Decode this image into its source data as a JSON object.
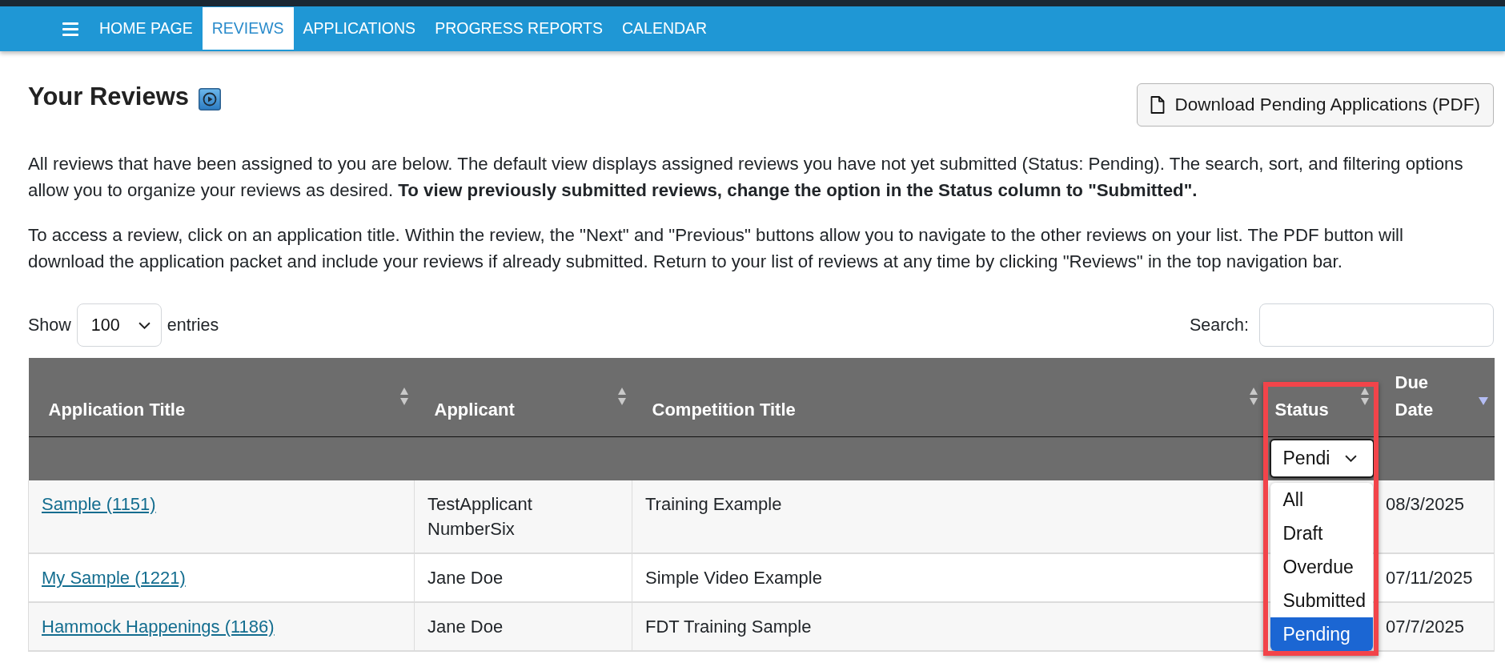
{
  "top_nav": {
    "items": [
      {
        "label": "HOME PAGE",
        "selected": false
      },
      {
        "label": "REVIEWS",
        "selected": true
      },
      {
        "label": "APPLICATIONS",
        "selected": false
      },
      {
        "label": "PROGRESS REPORTS",
        "selected": false
      },
      {
        "label": "CALENDAR",
        "selected": false
      }
    ]
  },
  "page": {
    "title": "Your Reviews",
    "download_button": "Download Pending Applications (PDF)",
    "paragraphs": [
      "All reviews that have been assigned to you are below. The default view displays assigned reviews you have not yet submitted (Status: Pending). The search, sort, and filtering options allow you to organize your reviews as desired. **To view previously submitted reviews, change the option in the Status column to \"Submitted\".**",
      "To access a review, click on an application title. Within the review, the \"Next\" and \"Previous\" buttons allow you to navigate to the other reviews on your list. The PDF button will download the application packet and include your reviews if already submitted. Return to your list of reviews at any time by clicking \"Reviews\" in the top navigation bar."
    ]
  },
  "table_controls": {
    "show_label": "Show",
    "page_size": "100",
    "entries_label": "entries",
    "search_label": "Search:"
  },
  "table": {
    "columns": [
      {
        "label": "Application Title",
        "sorted": false,
        "highlighted": false
      },
      {
        "label": "Applicant",
        "sorted": false,
        "highlighted": false
      },
      {
        "label": "Competition Title",
        "sorted": false,
        "highlighted": false
      },
      {
        "label": "Status",
        "sorted": false,
        "highlighted": true,
        "filter": {
          "value": "Pendi",
          "expanded": true,
          "options": [
            {
              "label": "All",
              "selected": false
            },
            {
              "label": "Draft",
              "selected": false
            },
            {
              "label": "Overdue",
              "selected": false
            },
            {
              "label": "Submitted",
              "selected": false
            },
            {
              "label": "Pending",
              "selected": true
            }
          ]
        }
      },
      {
        "label": "Due Date",
        "sorted": true,
        "highlighted": false
      }
    ],
    "rows": [
      {
        "title": "Sample (1151)",
        "applicant": "TestApplicant NumberSix",
        "competition": "Training Example",
        "due_date": "08/3/2025"
      },
      {
        "title": "My Sample (1221)",
        "applicant": "Jane Doe",
        "competition": "Simple Video Example",
        "due_date": "07/11/2025"
      },
      {
        "title": "Hammock Happenings (1186)",
        "applicant": "Jane Doe",
        "competition": "FDT Training Sample",
        "due_date": "07/7/2025"
      }
    ]
  }
}
